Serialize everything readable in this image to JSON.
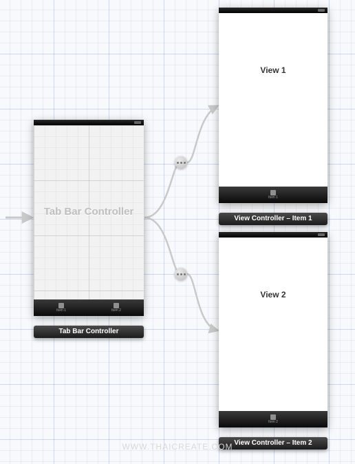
{
  "watermark": "WWW.THAICREATE.COM",
  "scenes": {
    "tabController": {
      "ghost_title": "Tab Bar Controller",
      "caption": "Tab Bar Controller",
      "tabs": [
        {
          "label": "Item 1"
        },
        {
          "label": "Item 2"
        }
      ]
    },
    "view1": {
      "body_label": "View 1",
      "caption": "View Controller – Item 1",
      "tab_label": "Item 1"
    },
    "view2": {
      "body_label": "View 2",
      "caption": "View Controller – Item 2",
      "tab_label": "Item 2"
    }
  }
}
